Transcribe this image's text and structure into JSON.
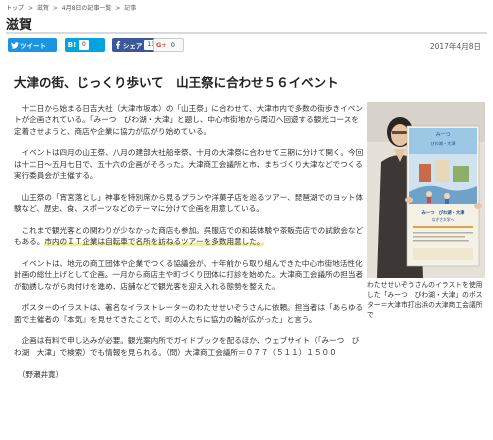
{
  "breadcrumb": {
    "items": [
      "トップ",
      "滋賀",
      "4月8日の記事一覧",
      "記事"
    ],
    "separator": ">"
  },
  "section": {
    "title": "滋賀"
  },
  "share": {
    "twitter_label": "ツイート",
    "hatena_label": "B!",
    "hatena_count": "0",
    "facebook_label": "シェア",
    "facebook_count": "11",
    "gplus_label": "G+",
    "gplus_count": "0"
  },
  "article": {
    "date": "2017年4月8日",
    "headline": "大津の街、じっくり歩いて　山王祭に合わせ５６イベント",
    "paragraphs": [
      "十二日から始まる日吉大社（大津市坂本）の「山王祭」に合わせて、大津市内で多数の街歩きイベントが企画されている。「みーつ　びわ湖・大津」と題し、中心市街地から周辺へ回遊する観光コースを定着させようと、商店や企業に協力が広がり始めている。",
      "イベントは四月の山王祭、八月の建部大社船幸祭、十月の大津祭に合わせて三期に分けて開く。今回は十二日～五月七日で、五十六の企画がそろった。大津商工会議所と市、まちづくり大津などでつくる実行委員会が主催する。",
      "山王祭の「宵宮落とし」神事を特別席から見るプランや洋菓子店を巡るツアー、琵琶湖でのヨット体験など、歴史、食、スポーツなどのテーマに分けて企画を用意している。"
    ],
    "paragraph4_a": "これまで観光客との関わりが少なかった商店も参加。呉服店での和装体験や茶販売店での試飲会などもある。",
    "paragraph4_highlight": "市内のＩＴ企業は自転車で名所を訪ねるツアーを多数用意した。",
    "paragraphs_after": [
      "イベントは、地元の商工団体や企業でつくる協議会が、十年前から取り組んできた中心市街地活性化計画の総仕上げとして企画。一月から商店主や町づくり団体に打診を始めた。大津商工会議所の担当者が勧誘しながら肉付けを進め、店舗などで観光客を迎え入れる態勢を整えた。",
      "ポスターのイラストは、著名なイラストレーターのわたせせいぞうさんに依頼。担当者は「あらゆる面で主催者の『本気』を見せてきたことで、町の人たちに協力の輪が広がった」と言う。",
      "企画は有料で申し込みが必要。観光案内所でガイドブックを配るほか、ウェブサイト（「みーつ　びわ湖　大津」で検索）でも情報を見られる。（問）大津商工会議所＝０７７（５１１）１５００"
    ],
    "byline": "（野瀬井寛）"
  },
  "photo": {
    "caption": "わたせせいぞうさんのイラストを使用した「みーつ　びわ湖・大津」のポスター＝大津市打出浜の大津商工会議所で",
    "poster_title_lines": [
      "みーつ　びわ湖・大津",
      "なぎさ大学へ"
    ],
    "poster_logo": "みーつ",
    "poster_subtitle": "びわ湖・大津"
  },
  "colors": {
    "twitter": "#1b95e0",
    "hatena": "#00a4de",
    "facebook": "#3b5998",
    "highlight": "#f6f08a",
    "rule": "#d9d9d9"
  },
  "icons": {
    "twitter": "bird-icon",
    "hatena": "hatena-bookmark-icon",
    "facebook": "facebook-f-icon",
    "gplus": "google-plus-icon"
  }
}
